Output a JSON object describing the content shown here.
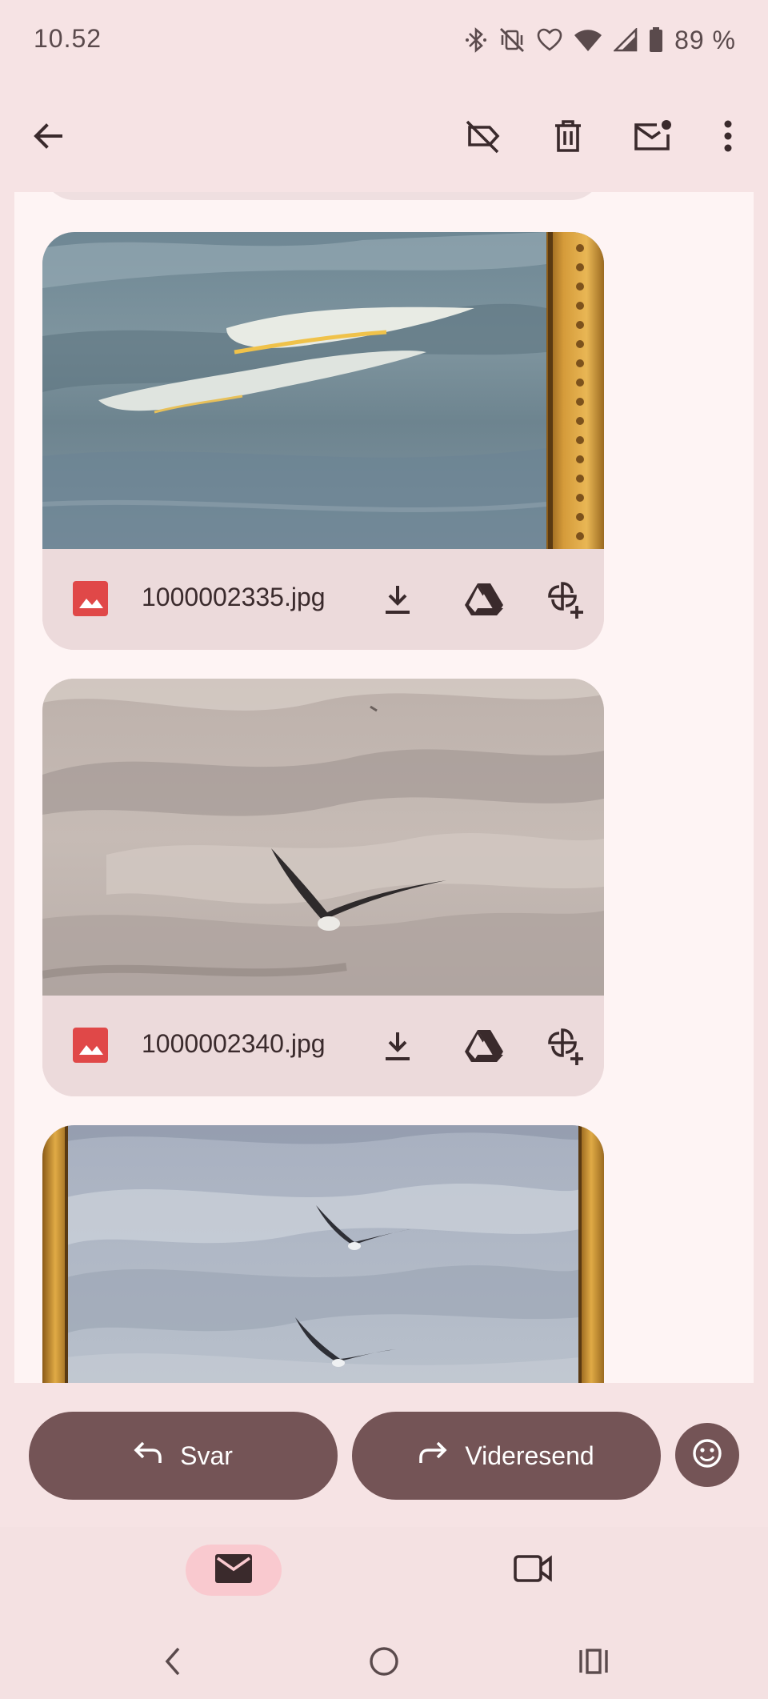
{
  "status_bar": {
    "time": "10.52",
    "battery": "89 %",
    "icons": [
      "bluetooth-icon",
      "vibrate-off-icon",
      "heart-icon",
      "wifi-icon",
      "signal-icon",
      "battery-icon"
    ]
  },
  "toolbar": {
    "icons": [
      "back-arrow-icon",
      "label-off-icon",
      "trash-icon",
      "mark-unread-icon",
      "more-vert-icon"
    ]
  },
  "attachments": [
    {
      "filename": "1000002335.jpg",
      "preview": "painting-sea-with-gilt-frame",
      "actions": [
        "download-icon",
        "drive-icon",
        "add-to-photos-icon"
      ]
    },
    {
      "filename": "1000002340.jpg",
      "preview": "painting-sky-with-seagull",
      "actions": [
        "download-icon",
        "drive-icon",
        "add-to-photos-icon"
      ]
    },
    {
      "preview": "painting-sky-with-two-seagulls-framed"
    }
  ],
  "actions": {
    "reply_label": "Svar",
    "forward_label": "Videresend",
    "emoji_icon": "emoji-icon"
  },
  "bottom_nav": {
    "items": [
      "mail-icon",
      "meet-video-icon"
    ]
  },
  "system_nav": [
    "back-chevron-icon",
    "home-circle-icon",
    "recents-icon"
  ],
  "colors": {
    "background": "#f6e3e4",
    "sheet": "#fef4f4",
    "card_bar": "#ecdadb",
    "accent_button": "#745456",
    "nav_active": "#f9c9cf",
    "image_icon_red": "#e04848"
  }
}
